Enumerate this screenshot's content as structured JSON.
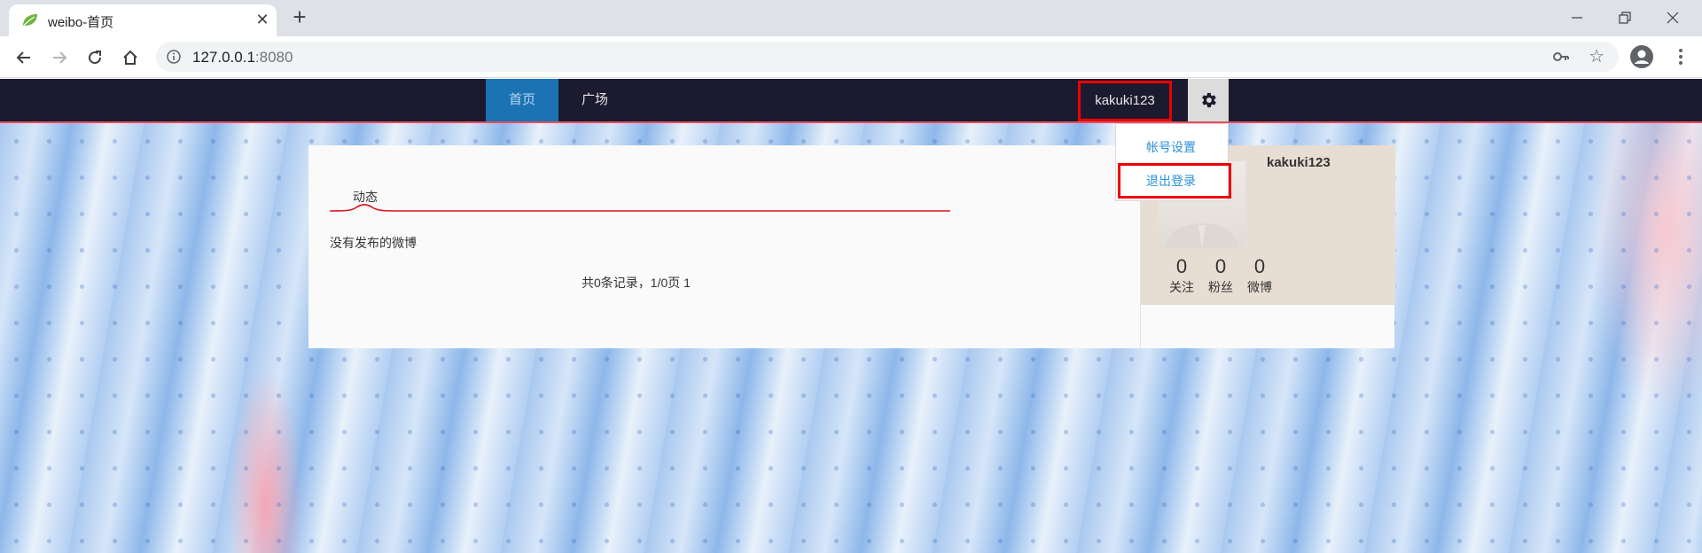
{
  "browser": {
    "tab_title": "weibo-首页",
    "url_host": "127.0.0.1",
    "url_port": ":8080"
  },
  "nav": {
    "home": "首页",
    "plaza": "广场",
    "username": "kakuki123"
  },
  "dropdown": {
    "account_settings": "帐号设置",
    "logout": "退出登录"
  },
  "main": {
    "tab_feed": "动态",
    "empty_message": "没有发布的微博",
    "pagination": "共0条记录，1/0页 1"
  },
  "profile": {
    "name": "kakuki123",
    "stats": [
      {
        "value": "0",
        "label": "关注"
      },
      {
        "value": "0",
        "label": "粉丝"
      },
      {
        "value": "0",
        "label": "微博"
      }
    ]
  },
  "colors": {
    "navbar_bg": "#1c1a2e",
    "nav_active_bg": "#1b73b4",
    "highlight_box": "#ee0000",
    "link_blue": "#2a91d8"
  },
  "icons": {
    "favicon": "leaf-icon",
    "back": "arrow-left-icon",
    "forward": "arrow-right-icon",
    "reload": "reload-icon",
    "home": "home-icon",
    "info": "info-icon",
    "key": "key-icon",
    "star": "star-icon",
    "profile": "account-circle-icon",
    "menu": "kebab-menu-icon",
    "gear": "gear-icon"
  }
}
